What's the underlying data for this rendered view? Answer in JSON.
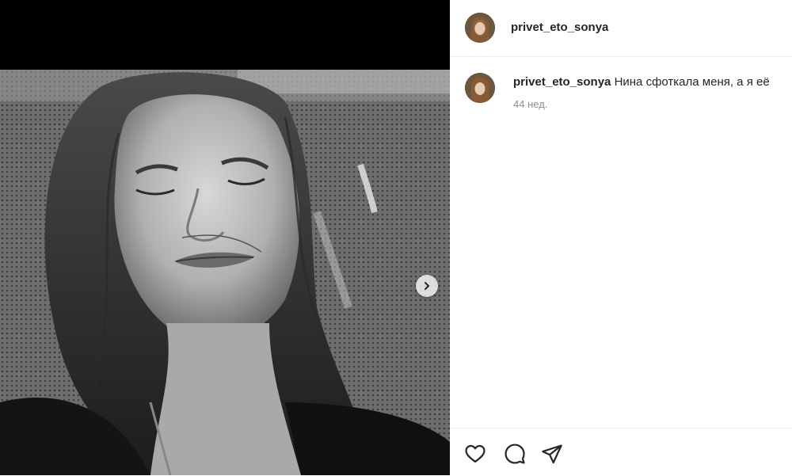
{
  "post": {
    "author": "privet_eto_sonya",
    "caption_author": "privet_eto_sonya",
    "caption_text": "Нина сфоткала меня, а я её",
    "timestamp": "44 нед."
  },
  "icons": {
    "next": "chevron-right-icon",
    "like": "heart-icon",
    "comment": "comment-bubble-icon",
    "share": "paper-plane-icon"
  },
  "colors": {
    "media_bg": "#000000",
    "text": "#262626",
    "muted": "#8e8e8e",
    "divider": "#efefef"
  }
}
